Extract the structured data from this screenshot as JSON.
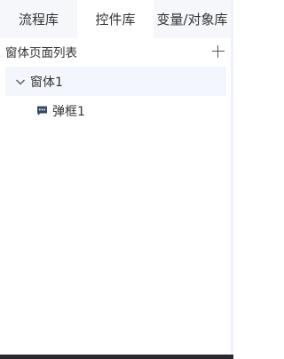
{
  "tabs": [
    {
      "label": "流程库",
      "active": false
    },
    {
      "label": "控件库",
      "active": true
    },
    {
      "label": "变量/对象库",
      "active": false
    }
  ],
  "section": {
    "title": "窗体页面列表",
    "add_icon": "plus-icon"
  },
  "tree": {
    "node": {
      "label": "窗体1",
      "expanded": true,
      "icon": "chevron-down-icon"
    },
    "children": [
      {
        "label": "弹框1",
        "icon": "message-dialog-icon"
      }
    ]
  },
  "colors": {
    "accent_icon": "#3b4a6b",
    "selected_bg": "#f3f6fc",
    "text": "#333333"
  }
}
